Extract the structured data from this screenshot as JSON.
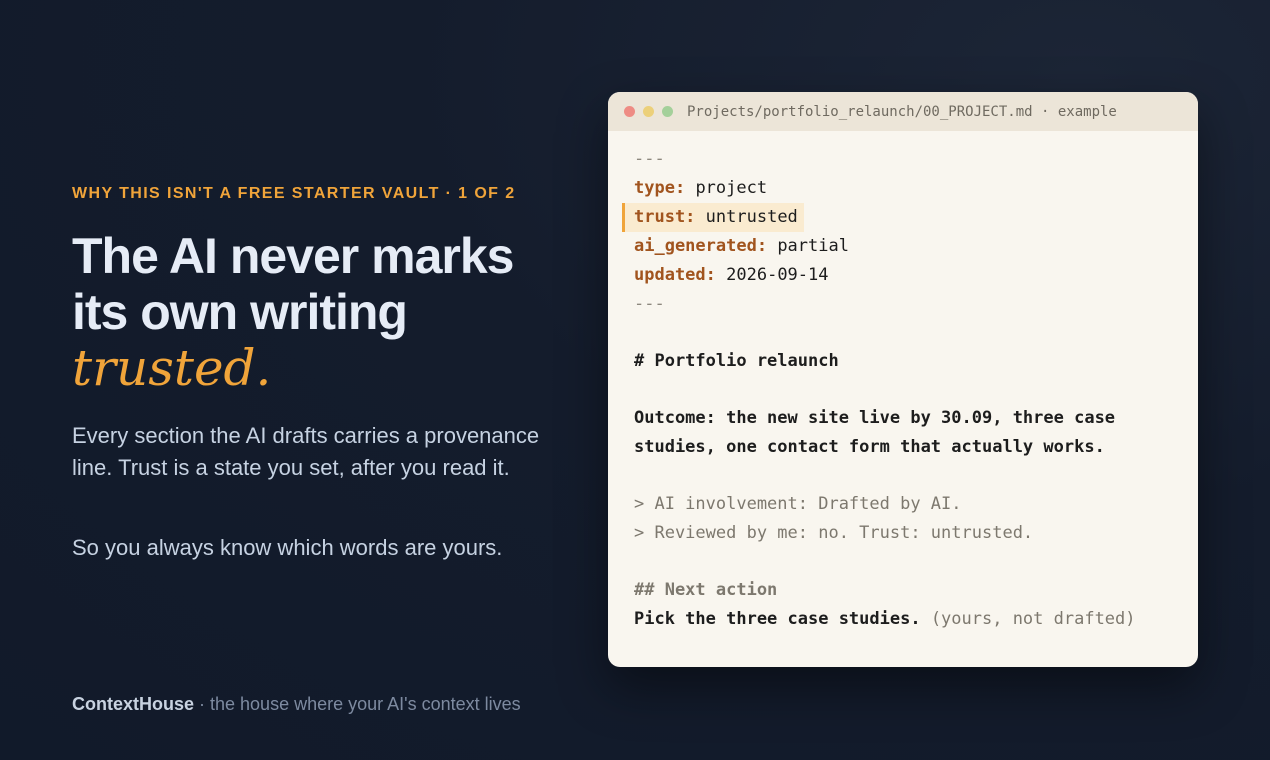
{
  "eyebrow": "WHY THIS ISN'T A FREE STARTER VAULT · 1 OF 2",
  "headline": {
    "line1": "The AI never marks",
    "line2": "its own writing",
    "accent": "trusted."
  },
  "body": {
    "paragraph1": "Every section the AI drafts carries a provenance line. Trust is a state you set, after you read it.",
    "paragraph2": "So you always know which words are yours."
  },
  "footer": {
    "brand": "ContextHouse",
    "tagline": " · the house where your AI's context lives"
  },
  "colors": {
    "accent": "#f0a43a",
    "background": "#141c2c",
    "card": "#f9f6ef",
    "yaml_key": "#a1541e"
  },
  "window": {
    "buttons": [
      "close-dot",
      "minimize-dot",
      "maximize-dot"
    ],
    "title": "Projects/portfolio_relaunch/00_PROJECT.md · example"
  },
  "file": {
    "fence_open": "---",
    "frontmatter": [
      {
        "key": "type:",
        "value": "project"
      },
      {
        "key": "trust:",
        "value": "untrusted"
      },
      {
        "key": "ai_generated:",
        "value": "partial"
      },
      {
        "key": "updated:",
        "value": "2026-09-14"
      }
    ],
    "fence_close": "---",
    "heading": "# Portfolio relaunch",
    "outcome_lines": [
      "Outcome: the new site live by 30.09, three case",
      "studies, one contact form that actually works."
    ],
    "quote_lines": [
      "> AI involvement: Drafted by AI.",
      "> Reviewed by me: no. Trust: untrusted."
    ],
    "subheading": "## Next action",
    "action": "Pick the three case studies.",
    "action_note": " (yours, not drafted)"
  }
}
